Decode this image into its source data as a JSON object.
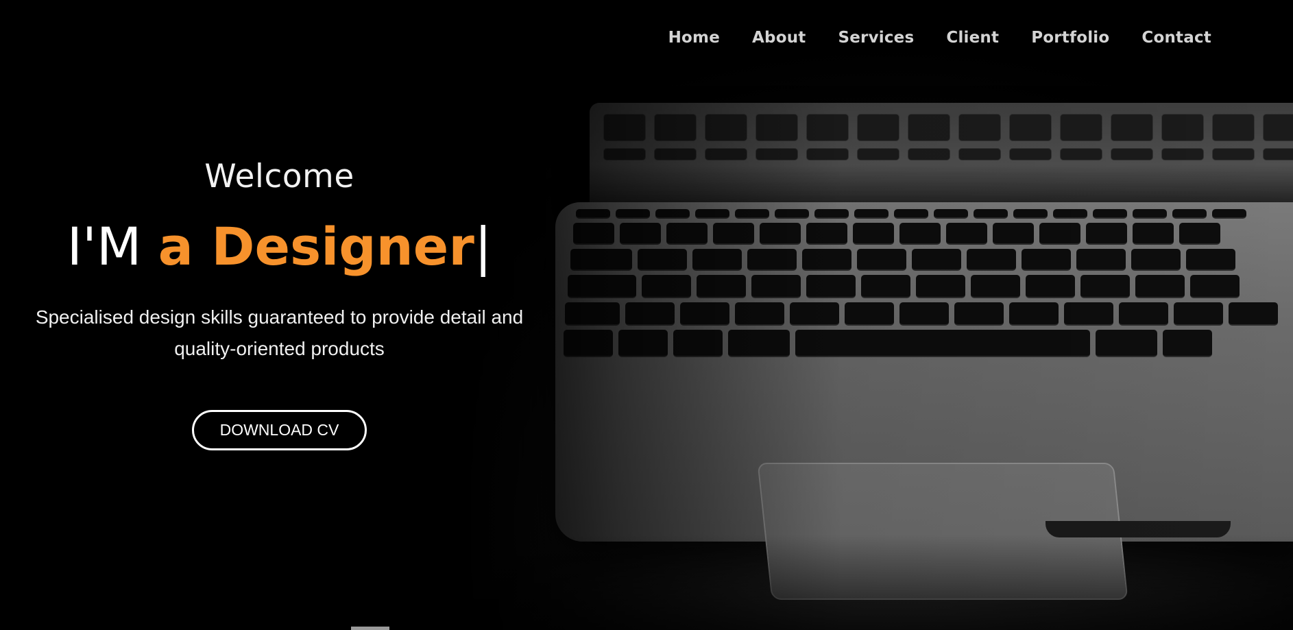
{
  "nav": {
    "items": [
      {
        "label": "Home"
      },
      {
        "label": "About"
      },
      {
        "label": "Services"
      },
      {
        "label": "Client"
      },
      {
        "label": "Portfolio"
      },
      {
        "label": "Contact"
      }
    ]
  },
  "hero": {
    "welcome": "Welcome",
    "headline_prefix": "I'M ",
    "headline_accent": "a Designer",
    "headline_cursor": "|",
    "subtext": "Specialised design skills guaranteed to provide detail and quality-oriented products",
    "button_label": "DOWNLOAD CV"
  },
  "colors": {
    "accent": "#f7922c",
    "background": "#000000",
    "text": "#ffffff",
    "nav_text": "#d4d4d4"
  }
}
